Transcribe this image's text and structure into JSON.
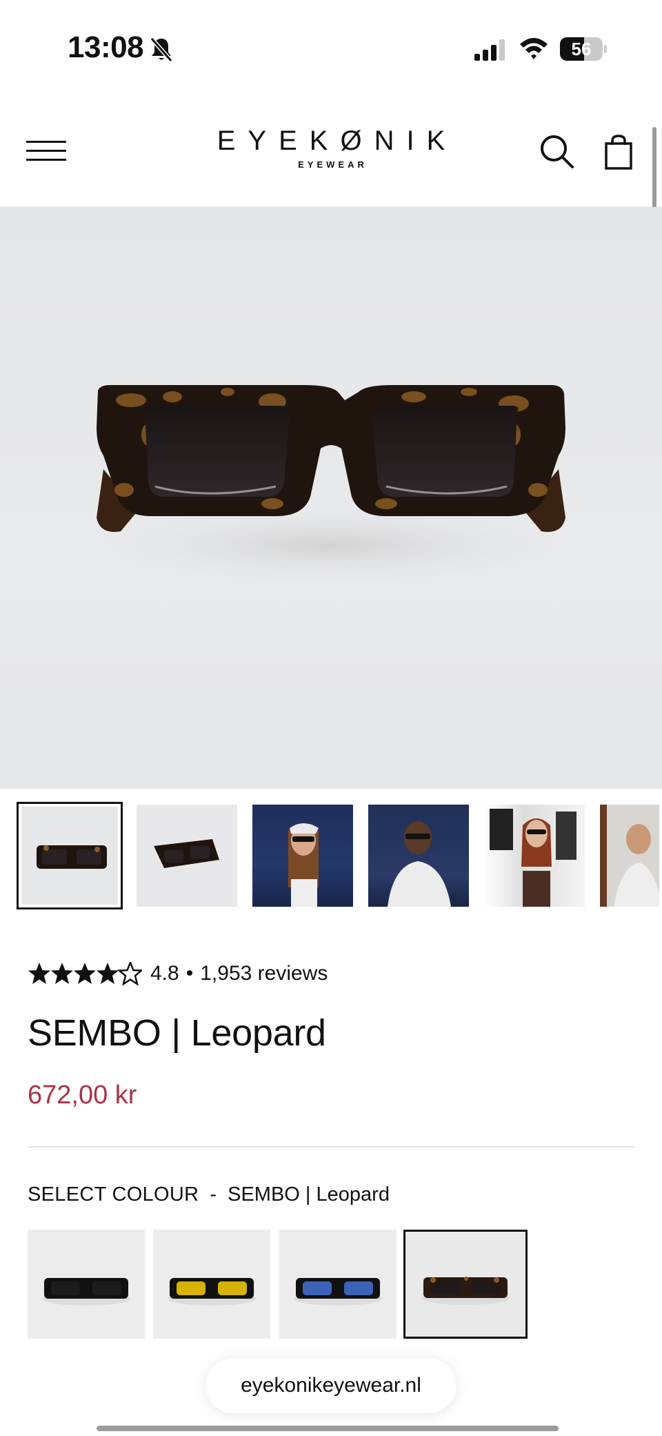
{
  "status_bar": {
    "time": "13:08",
    "battery": "56",
    "battery_level_pct": 56
  },
  "header": {
    "brand": "EYEKØNIK",
    "brand_sub": "EYEWEAR",
    "icons": [
      "menu-icon",
      "search-icon",
      "shopping-bag-icon"
    ]
  },
  "hero": {
    "image": "leopard-tortoise-sunglasses-photo"
  },
  "thumbnails": [
    "leopard-sunglasses-front",
    "leopard-sunglasses-angled",
    "model-woman-headscarf-beach",
    "model-man-night-beach",
    "model-woman-black-top",
    "model-man-white-shirt"
  ],
  "rating": {
    "value": "4.8",
    "separator": "•",
    "count": "1,953 reviews",
    "stars": 4.5
  },
  "product": {
    "title": "SEMBO | Leopard",
    "price": "672,00 kr"
  },
  "colour": {
    "label": "SELECT COLOUR",
    "dash": "-",
    "selected": "SEMBO | Leopard",
    "options": [
      "black",
      "yellow-lens",
      "blue-lens",
      "leopard"
    ]
  },
  "browser": {
    "url": "eyekonikeyewear.nl"
  },
  "colors": {
    "accent_price": "#a8324a",
    "text": "#111111",
    "hero_bg": "#e6e7e9"
  }
}
